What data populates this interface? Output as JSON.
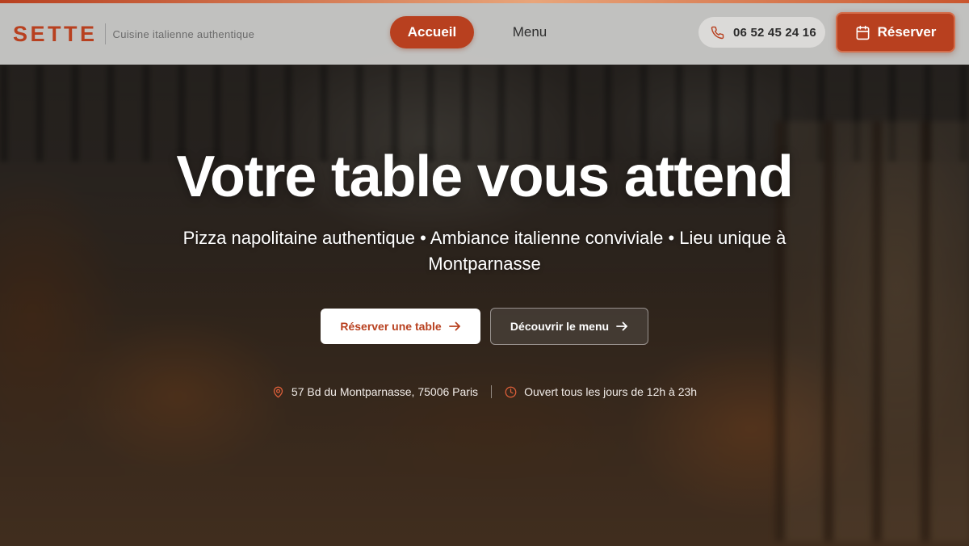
{
  "header": {
    "brand_name": "SETTE",
    "brand_tagline": "Cuisine italienne authentique",
    "nav": {
      "home_label": "Accueil",
      "menu_label": "Menu"
    },
    "phone": "06 52 45 24 16",
    "reserve_label": "Réserver"
  },
  "hero": {
    "title": "Votre table vous attend",
    "subtitle": "Pizza napolitaine authentique • Ambiance italienne conviviale • Lieu unique à Montparnasse",
    "cta_primary": "Réserver une table",
    "cta_secondary": "Découvrir le menu",
    "address": "57 Bd du Montparnasse, 75006 Paris",
    "hours": "Ouvert tous les jours de 12h à 23h"
  },
  "icons": {
    "phone": "phone-icon",
    "calendar": "calendar-icon",
    "arrow": "arrow-right-icon",
    "location": "map-pin-icon",
    "clock": "clock-icon"
  },
  "colors": {
    "accent": "#b8401f",
    "header_bg": "#cdcdcb",
    "text_light": "#ffffff"
  }
}
